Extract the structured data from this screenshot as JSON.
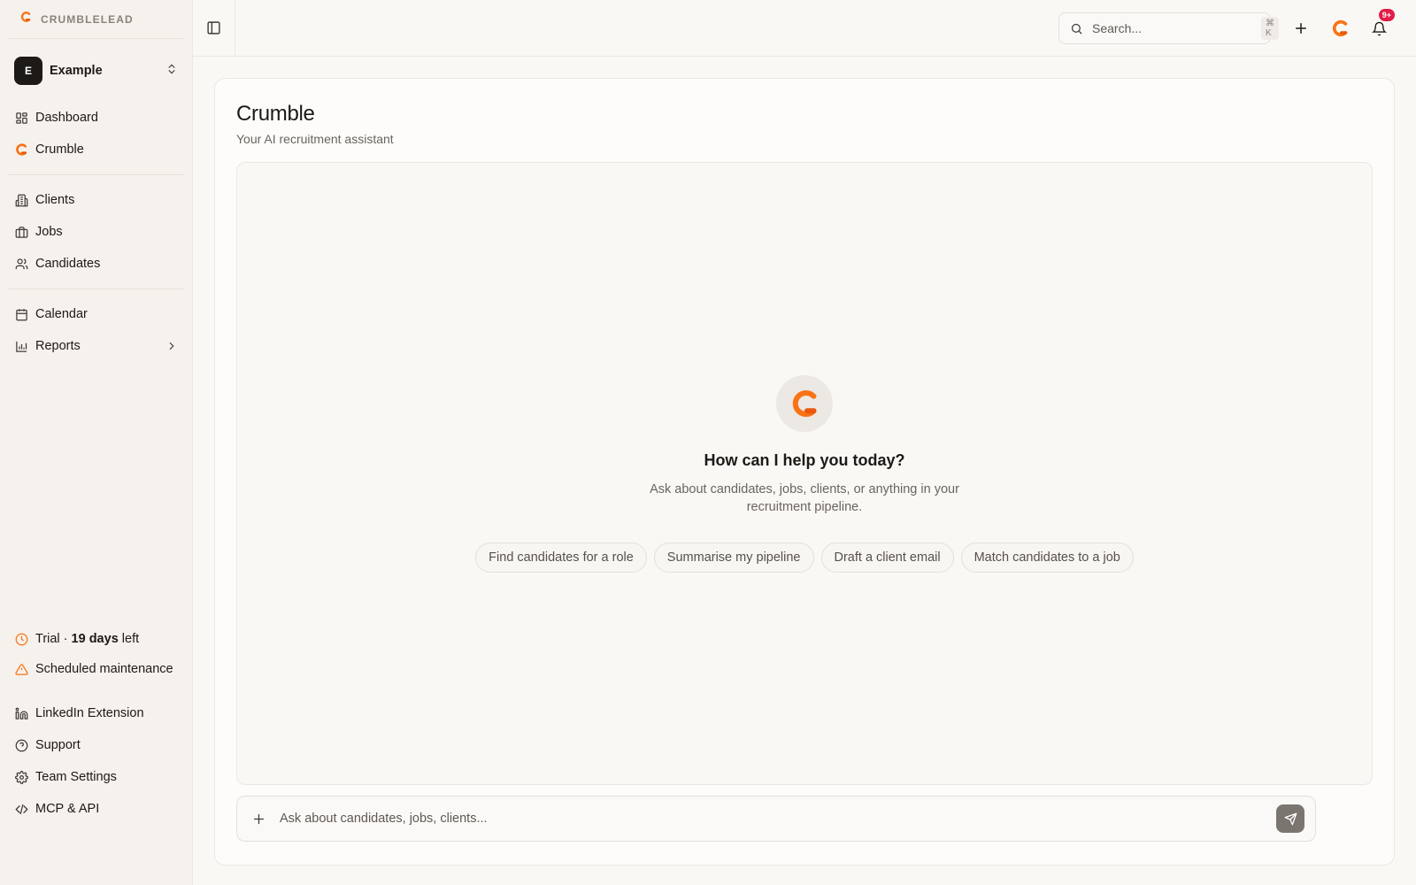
{
  "brand": {
    "name": "CRUMBLELEAD",
    "icon": "crumble-logo-icon",
    "accent": "#f97316"
  },
  "workspace": {
    "initial": "E",
    "name": "Example"
  },
  "sidebar": {
    "primary": [
      {
        "label": "Dashboard",
        "icon": "dashboard-icon"
      },
      {
        "label": "Crumble",
        "icon": "crumble-logo-icon"
      }
    ],
    "records": [
      {
        "label": "Clients",
        "icon": "building-icon"
      },
      {
        "label": "Jobs",
        "icon": "briefcase-icon"
      },
      {
        "label": "Candidates",
        "icon": "users-icon"
      }
    ],
    "tools": [
      {
        "label": "Calendar",
        "icon": "calendar-icon"
      },
      {
        "label": "Reports",
        "icon": "bar-chart-icon"
      }
    ],
    "trial": {
      "prefix": "Trial · ",
      "days": "19 days",
      "suffix": " left"
    },
    "maintenance": "Scheduled maintenance",
    "footer": [
      {
        "label": "LinkedIn Extension",
        "icon": "linkedin-icon"
      },
      {
        "label": "Support",
        "icon": "help-circle-icon"
      },
      {
        "label": "Team Settings",
        "icon": "gear-icon"
      },
      {
        "label": "MCP & API",
        "icon": "code-icon"
      }
    ]
  },
  "topbar": {
    "search_placeholder": "Search...",
    "shortcut": "⌘ K",
    "notifications_badge": "9+"
  },
  "page": {
    "title": "Crumble",
    "subtitle": "Your AI recruitment assistant"
  },
  "chat": {
    "heading": "How can I help you today?",
    "description": "Ask about candidates, jobs, clients, or anything in your recruitment pipeline.",
    "suggestions": [
      "Find candidates for a role",
      "Summarise my pipeline",
      "Draft a client email",
      "Match candidates to a job"
    ],
    "input_placeholder": "Ask about candidates, jobs, clients..."
  }
}
